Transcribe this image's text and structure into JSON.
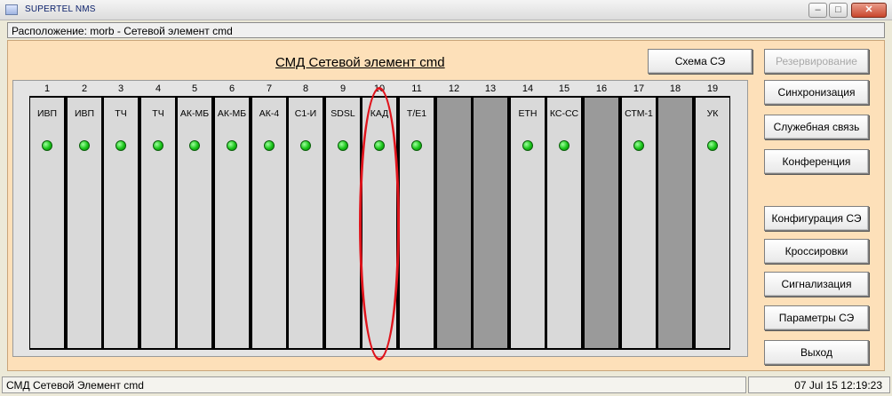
{
  "window": {
    "title": "SUPERTEL NMS"
  },
  "location": {
    "text": "Расположение: morb - Сетевой элемент cmd"
  },
  "page": {
    "title": "СМД Сетевой элемент cmd"
  },
  "buttons": {
    "scheme": "Схема СЭ",
    "reserve": "Резервирование",
    "sync": "Синхронизация",
    "service": "Служебная связь",
    "conference": "Конференция",
    "config": "Конфигурация СЭ",
    "cross": "Кроссировки",
    "alarm": "Сигнализация",
    "params": "Параметры СЭ",
    "exit": "Выход"
  },
  "slots": [
    {
      "num": "1",
      "label": "ИВП",
      "led": true
    },
    {
      "num": "2",
      "label": "ИВП",
      "led": true
    },
    {
      "num": "3",
      "label": "ТЧ",
      "led": true
    },
    {
      "num": "4",
      "label": "ТЧ",
      "led": true
    },
    {
      "num": "5",
      "label": "АК-МБ",
      "led": true
    },
    {
      "num": "6",
      "label": "АК-МБ",
      "led": true
    },
    {
      "num": "7",
      "label": "АК-4",
      "led": true
    },
    {
      "num": "8",
      "label": "С1-И",
      "led": true
    },
    {
      "num": "9",
      "label": "SDSL",
      "led": true
    },
    {
      "num": "10",
      "label": "КАД",
      "led": true
    },
    {
      "num": "11",
      "label": "Т/Е1",
      "led": true
    },
    {
      "num": "12",
      "label": "",
      "led": false
    },
    {
      "num": "13",
      "label": "",
      "led": false
    },
    {
      "num": "14",
      "label": "ETH",
      "led": true
    },
    {
      "num": "15",
      "label": "КС-СС",
      "led": true
    },
    {
      "num": "16",
      "label": "",
      "led": false
    },
    {
      "num": "17",
      "label": "СТМ-1",
      "led": true
    },
    {
      "num": "18",
      "label": "",
      "led": false
    },
    {
      "num": "19",
      "label": "УК",
      "led": true
    }
  ],
  "status": {
    "text": "СМД Сетевой Элемент cmd",
    "datetime": "07 Jul 15  12:19:23"
  },
  "colors": {
    "panel": "#fde0b9",
    "led": "#18c418",
    "highlight": "#e0141c"
  }
}
